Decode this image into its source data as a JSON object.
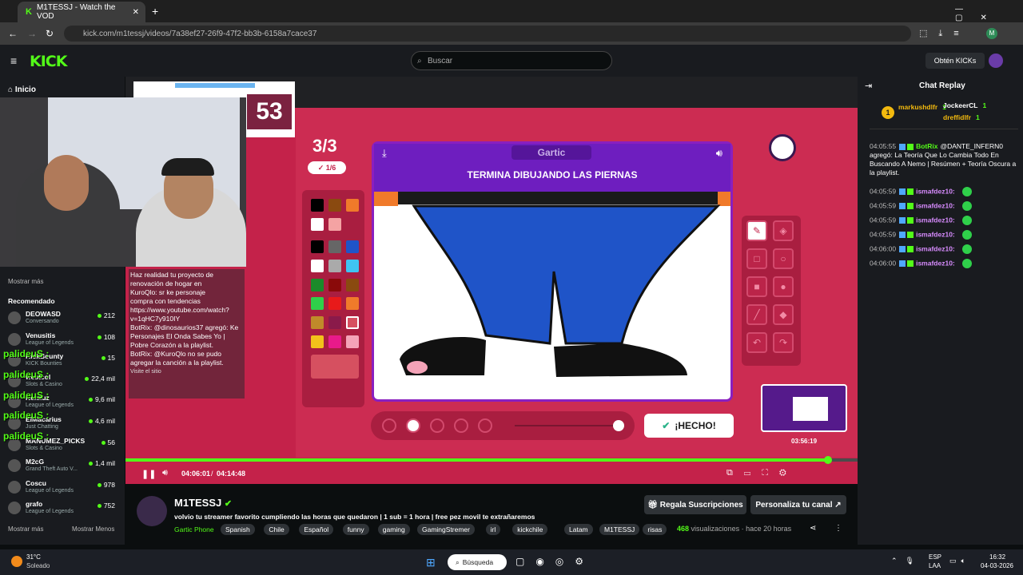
{
  "browser": {
    "tab_title": "M1TESSJ - Watch the VOD",
    "url": "kick.com/m1tessj/videos/7a38ef27-26f9-47f2-bb3b-6158a7cace37"
  },
  "header": {
    "logo": "KICK",
    "search_placeholder": "Buscar",
    "kicks_button": "Obtén KICKs"
  },
  "sidebar": {
    "home": "Inicio",
    "show_more_top": "Mostrar más",
    "recommended_title": "Recomendado",
    "items": [
      {
        "name": "DEOWASD",
        "category": "Conversando",
        "viewers": "212"
      },
      {
        "name": "Venusitis",
        "category": "League of Legends",
        "viewers": "108"
      },
      {
        "name": "KickBounty",
        "category": "KICK Bounties",
        "viewers": "15"
      },
      {
        "name": "westcol",
        "category": "Slots & Casino",
        "viewers": "22,4 mil"
      },
      {
        "name": "Nexxuz",
        "category": "League of Legends",
        "viewers": "9,6 mil"
      },
      {
        "name": "ElMacarius",
        "category": "Just Chatting",
        "viewers": "4,6 mil"
      },
      {
        "name": "MANUMEZ_PICKS",
        "category": "Slots & Casino",
        "viewers": "56"
      },
      {
        "name": "M2cG",
        "category": "Grand Theft Auto V...",
        "viewers": "1,4 mil"
      },
      {
        "name": "Coscu",
        "category": "League of Legends",
        "viewers": "978"
      },
      {
        "name": "grafo",
        "category": "League of Legends",
        "viewers": "752"
      }
    ],
    "overlay_text": "palideuS :",
    "show_more": "Mostrar más",
    "show_less": "Mostrar Menos"
  },
  "video": {
    "score_digits": "53",
    "round": "3/3",
    "round_sub": "1/6",
    "game_logo": "Gartic",
    "prompt": "TERMINA DIBUJANDO LAS PIERNAS",
    "done_button": "¡HECHO!",
    "preview_time": "03:56:19",
    "time_current": "04:06:01",
    "time_total": "04:14:48",
    "progress": 0.96,
    "overlay_chat": [
      "Haz realidad tu proyecto de renovación de hogar en",
      "KuroQlo: sr ke personaje",
      "compra con tendencias",
      "https://www.youtube.com/watch?v=1qHC7y910IY",
      "BotRix: @dinosaurios37 agregó: Ke Personajes El Onda Sabes Yo | Pobre Corazón a la playlist.",
      "BotRix: @KuroQlo no se pudo agregar la canción a la playlist.",
      "Visite el sitio"
    ]
  },
  "stream": {
    "channel": "M1TESSJ",
    "title": "volvio tu streamer favorito cumpliendo las horas que quedaron | 1 sub = 1 hora | free pez movil te extrañaremos",
    "category": "Gartic Phone",
    "tags": [
      "Spanish",
      "Chile",
      "Español",
      "funny",
      "gaming",
      "GamingStremer",
      "irl",
      "kickchile",
      "Latam",
      "M1TESSJ",
      "risas"
    ],
    "subs_button": "Regala Suscripciones",
    "customize_button": "Personaliza tu canal",
    "views": "468",
    "views_label": "visualizaciones",
    "ago": "hace 20 horas"
  },
  "chat": {
    "title": "Chat Replay",
    "top_gifters": [
      {
        "name": "markushdlfr",
        "count": "1"
      },
      {
        "name": "JockeerCL",
        "count": "1"
      },
      {
        "name": "dreffidlfr",
        "count": "1"
      }
    ],
    "messages": [
      {
        "time": "04:05:55",
        "user": "BotRix",
        "text": "@DANTE_INFERN0 agregó: La Teoría Que Lo Cambia Todo En Buscando A Nemo | Resúmen + Teoría Oscura a la playlist."
      },
      {
        "time": "04:05:59",
        "user": "ismafdez10:",
        "text": ""
      },
      {
        "time": "04:05:59",
        "user": "ismafdez10:",
        "text": ""
      },
      {
        "time": "04:05:59",
        "user": "ismafdez10:",
        "text": ""
      },
      {
        "time": "04:05:59",
        "user": "ismafdez10:",
        "text": ""
      },
      {
        "time": "04:06:00",
        "user": "ismafdez10:",
        "text": ""
      },
      {
        "time": "04:06:00",
        "user": "ismafdez10:",
        "text": ""
      }
    ]
  },
  "taskbar": {
    "temp": "31°C",
    "weather": "Soleado",
    "search": "Búsqueda",
    "lang": "ESP",
    "lang_sub": "LAA",
    "time": "16:32",
    "date": "04-03-2026"
  },
  "colors": {
    "accent": "#53fc18",
    "game_bg": "#cc2c52",
    "gartic_purple": "#6e1ebf"
  }
}
